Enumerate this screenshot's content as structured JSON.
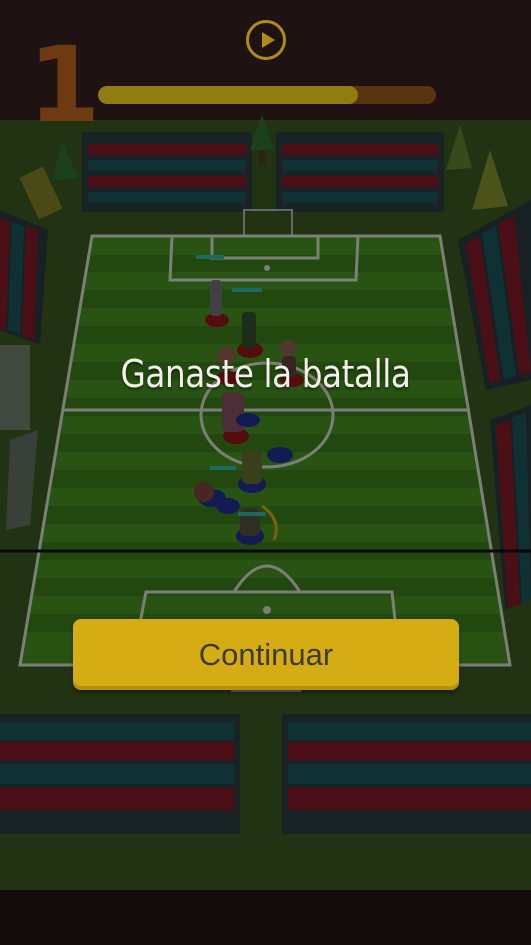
{
  "hud": {
    "level": "1",
    "progress_fraction": 0.77,
    "play_icon": "play-circle-icon"
  },
  "result": {
    "title": "Ganaste la batalla",
    "continue_label": "Continuar"
  },
  "colors": {
    "accent_yellow": "#d6ac14",
    "pitch_green": "#3f8a1a",
    "stand_red": "#7a1620",
    "stand_teal": "#145055",
    "team_red": "#8c1010",
    "team_blue": "#1a2a8c"
  }
}
